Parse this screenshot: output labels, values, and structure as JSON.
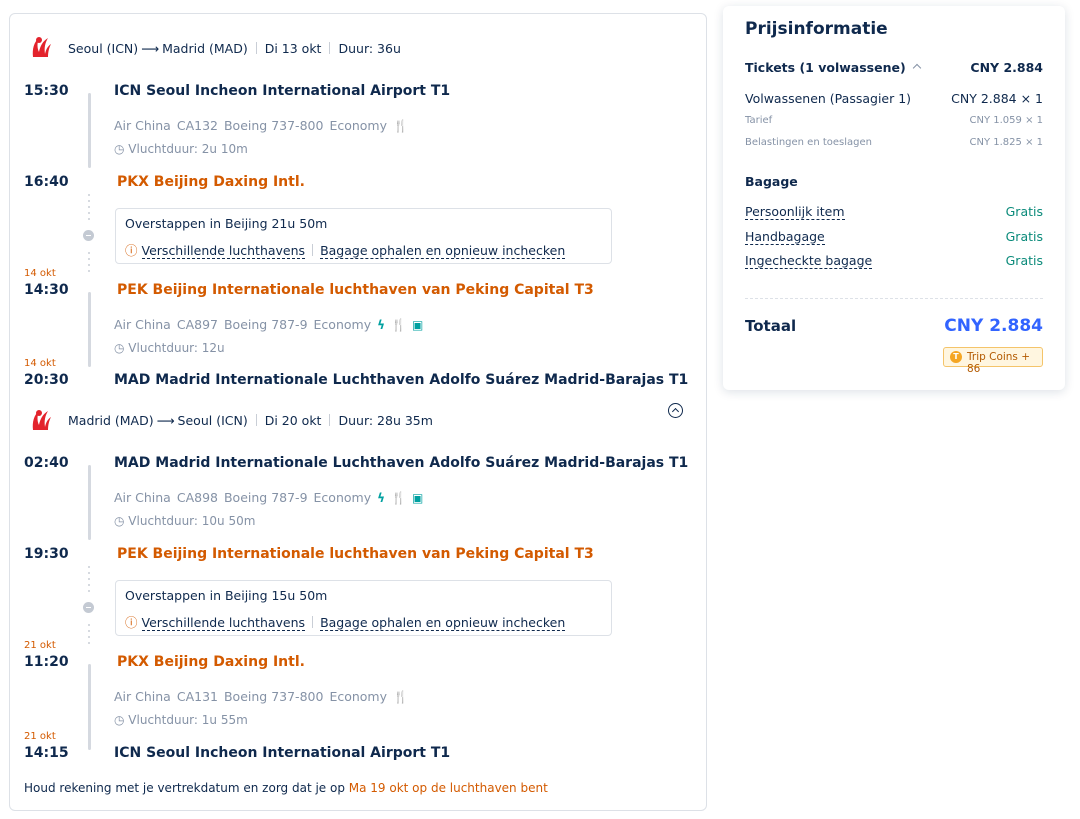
{
  "flights": {
    "outbound": {
      "route_from": "Seoul (ICN)",
      "route_to": "Madrid (MAD)",
      "date": "Di 13 okt",
      "duration": "Duur: 36u",
      "stops": [
        {
          "time": "15:30",
          "airport": "ICN Seoul Incheon International Airport T1"
        },
        {
          "time": "16:40",
          "airport": "PKX Beijing Daxing Intl."
        },
        {
          "datehint": "14 okt",
          "time": "14:30",
          "airport": "PEK Beijing Internationale luchthaven van Peking Capital T3"
        },
        {
          "datehint": "14 okt",
          "time": "20:30",
          "airport": "MAD Madrid Internationale Luchthaven Adolfo Suárez Madrid-Barajas T1"
        }
      ],
      "segments": [
        {
          "airline": "Air China",
          "flight": "CA132",
          "aircraft": "Boeing 737-800",
          "cabin": "Economy",
          "duration": "Vluchtduur: 2u 10m",
          "amenities": [
            "meal-icon"
          ]
        },
        {
          "airline": "Air China",
          "flight": "CA897",
          "aircraft": "Boeing 787-9",
          "cabin": "Economy",
          "duration": "Vluchtduur: 12u",
          "amenities": [
            "power-icon",
            "meal-icon",
            "entertainment-icon"
          ]
        }
      ],
      "transfer": {
        "text": "Overstappen in Beijing  21u 50m",
        "airports": "Verschillende luchthavens",
        "baggage": "Bagage ophalen en opnieuw inchecken"
      }
    },
    "inbound": {
      "route_from": "Madrid (MAD)",
      "route_to": "Seoul (ICN)",
      "date": "Di 20 okt",
      "duration": "Duur: 28u 35m",
      "stops": [
        {
          "time": "02:40",
          "airport": "MAD Madrid Internationale Luchthaven Adolfo Suárez Madrid-Barajas T1"
        },
        {
          "time": "19:30",
          "airport": "PEK Beijing Internationale luchthaven van Peking Capital T3"
        },
        {
          "datehint": "21 okt",
          "time": "11:20",
          "airport": "PKX Beijing Daxing Intl."
        },
        {
          "datehint": "21 okt",
          "time": "14:15",
          "airport": "ICN Seoul Incheon International Airport T1"
        }
      ],
      "segments": [
        {
          "airline": "Air China",
          "flight": "CA898",
          "aircraft": "Boeing 787-9",
          "cabin": "Economy",
          "duration": "Vluchtduur: 10u 50m",
          "amenities": [
            "power-icon",
            "meal-icon",
            "entertainment-icon"
          ]
        },
        {
          "airline": "Air China",
          "flight": "CA131",
          "aircraft": "Boeing 737-800",
          "cabin": "Economy",
          "duration": "Vluchtduur: 1u 55m",
          "amenities": [
            "meal-icon"
          ]
        }
      ],
      "transfer": {
        "text": "Overstappen in Beijing  15u 50m",
        "airports": "Verschillende luchthavens",
        "baggage": "Bagage ophalen en opnieuw inchecken"
      }
    },
    "note_prefix": "Houd rekening met je vertrekdatum en zorg dat je op ",
    "note_highlight": "Ma 19 okt op de luchthaven bent"
  },
  "price": {
    "title": "Prijsinformatie",
    "tickets_label": "Tickets (1 volwassene)",
    "tickets_total": "CNY 2.884",
    "adult_label": "Volwassenen (Passagier 1)",
    "adult_value": "CNY 2.884 × 1",
    "fare_label": "Tarief",
    "fare_value": "CNY 1.059 × 1",
    "tax_label": "Belastingen en toeslagen",
    "tax_value": "CNY 1.825 × 1",
    "baggage_title": "Bagage",
    "baggage": [
      {
        "label": "Persoonlijk item",
        "value": "Gratis"
      },
      {
        "label": "Handbagage",
        "value": "Gratis"
      },
      {
        "label": "Ingecheckte bagage",
        "value": "Gratis"
      }
    ],
    "total_label": "Totaal",
    "total_value": "CNY 2.884",
    "coins": "Trip Coins + 86"
  },
  "colors": {
    "accent_blue": "#3264ff",
    "orange": "#d35a00",
    "teal": "#00a0a0",
    "green": "#0a8a7a"
  }
}
